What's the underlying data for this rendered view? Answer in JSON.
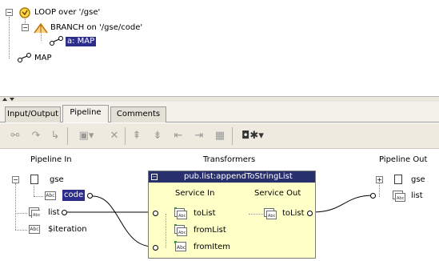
{
  "tree": {
    "loop_label": "LOOP over '/gse'",
    "branch_label": "BRANCH on '/gse/code'",
    "map_child_label": "a: MAP",
    "map_label": "MAP"
  },
  "tabs": [
    {
      "label": "Input/Output"
    },
    {
      "label": "Pipeline"
    },
    {
      "label": "Comments"
    }
  ],
  "toolbar": {
    "icons": [
      "link-icon",
      "forward-icon",
      "branch-icon",
      "abc-dropdown-icon",
      "delete-icon",
      "shift-up-icon",
      "shift-down-icon",
      "shift-left-icon",
      "shift-right-icon",
      "grid-icon",
      "map-options-icon"
    ]
  },
  "pipeline": {
    "headers": {
      "pipeline_in": "Pipeline In",
      "transformers": "Transformers",
      "pipeline_out": "Pipeline Out"
    },
    "in_items": {
      "gse": "gse",
      "code": "code",
      "list": "list",
      "iteration": "$iteration"
    },
    "service": {
      "title": "pub.list:appendToStringList",
      "service_in": "Service In",
      "service_out": "Service Out",
      "inputs": [
        "toList",
        "fromList",
        "fromItem"
      ],
      "output": "toList"
    },
    "out_items": {
      "gse": "gse",
      "list": "list"
    }
  },
  "colors": {
    "selection": "#2d2d8c",
    "service_title_bg": "#27306c",
    "service_body_bg": "#ffffc8",
    "loop_icon": "#d4a000",
    "branch_icon": "#e0a040"
  }
}
